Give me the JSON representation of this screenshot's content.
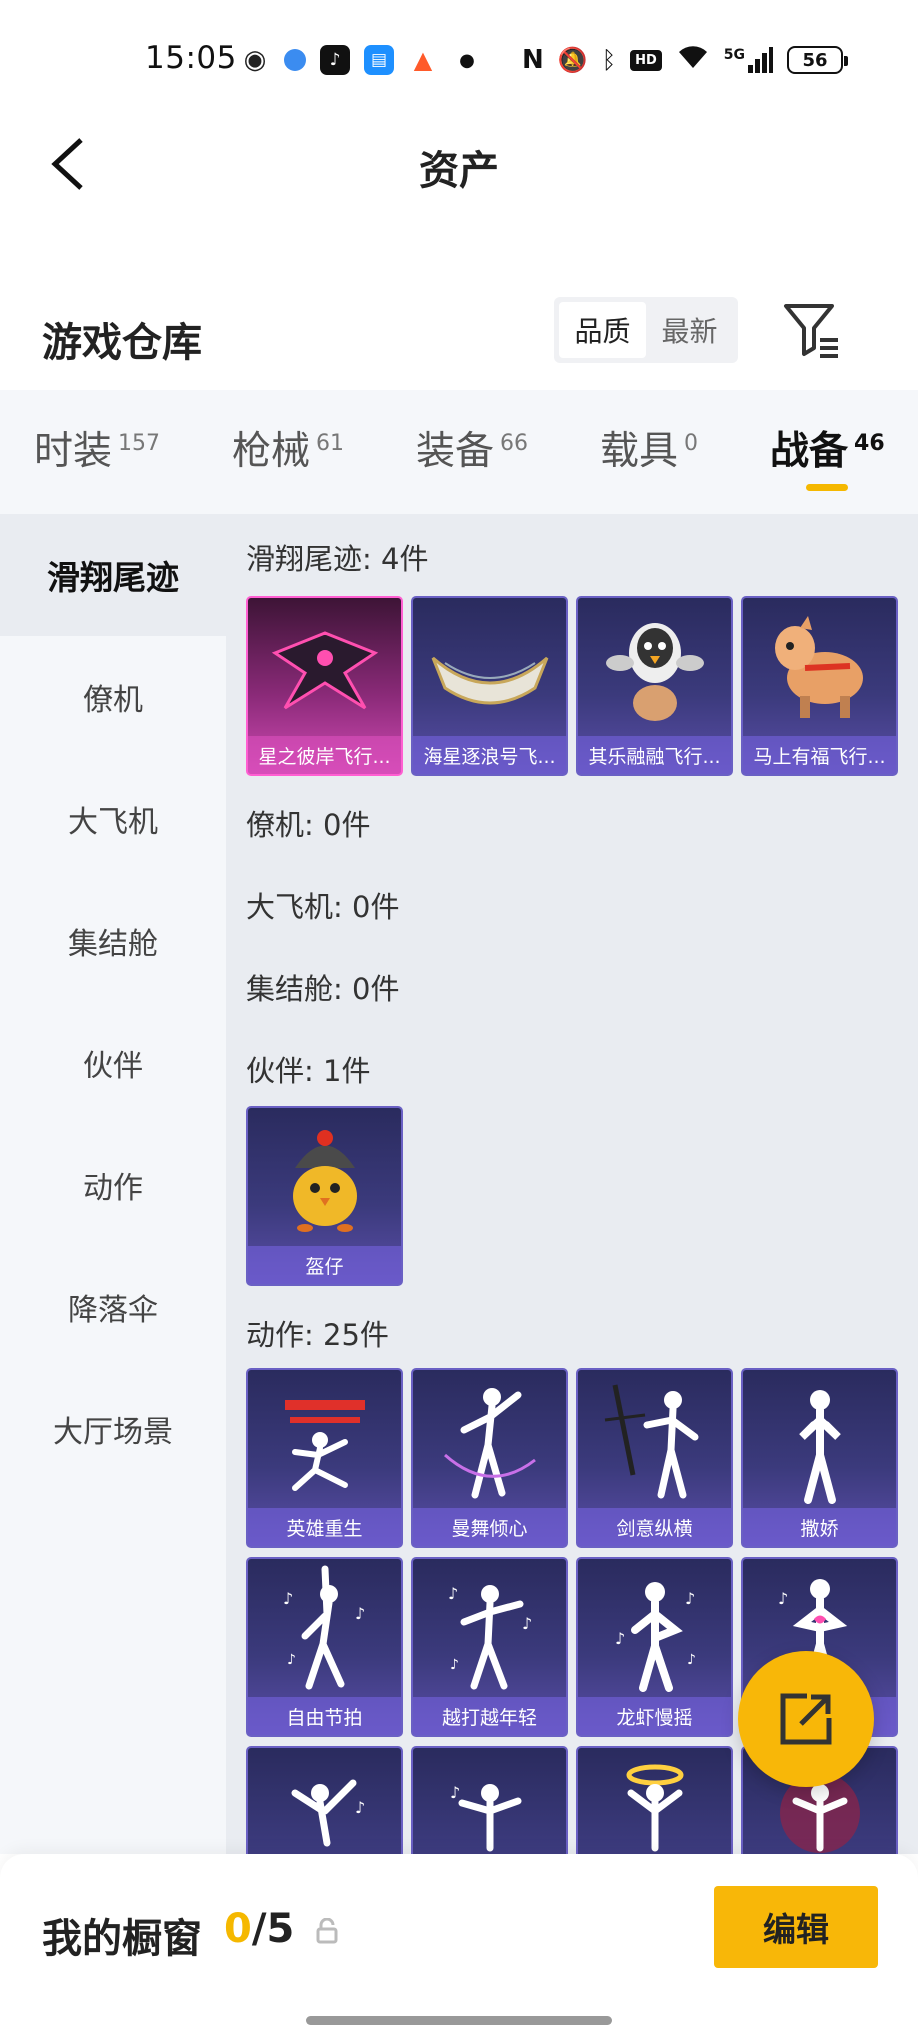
{
  "status_bar": {
    "time": "15:05",
    "battery": "56",
    "network": "5G",
    "hd_label": "HD",
    "icons": [
      "wechat-icon",
      "browser-icon",
      "tiktok-icon",
      "calendar-icon",
      "game-icon",
      "dot-icon",
      "nfc-icon",
      "mute-icon",
      "bluetooth-icon",
      "hd-icon",
      "wifi-icon",
      "signal-icon",
      "battery-icon"
    ]
  },
  "header": {
    "title": "资产",
    "back_icon": "back-arrow-icon"
  },
  "section": {
    "title": "游戏仓库",
    "sort_options": [
      "品质",
      "最新"
    ],
    "sort_selected": "品质",
    "filter_icon": "filter-icon"
  },
  "tabs": [
    {
      "label": "时装",
      "count": "157"
    },
    {
      "label": "枪械",
      "count": "61"
    },
    {
      "label": "装备",
      "count": "66"
    },
    {
      "label": "载具",
      "count": "0"
    },
    {
      "label": "战备",
      "count": "46",
      "active": true
    }
  ],
  "sidebar": [
    {
      "label": "滑翔尾迹",
      "active": true
    },
    {
      "label": "僚机"
    },
    {
      "label": "大飞机"
    },
    {
      "label": "集结舱"
    },
    {
      "label": "伙伴"
    },
    {
      "label": "动作"
    },
    {
      "label": "降落伞"
    },
    {
      "label": "大厅场景"
    }
  ],
  "groups": {
    "glide": {
      "title": "滑翔尾迹: 4件",
      "items": [
        "星之彼岸飞行...",
        "海星逐浪号飞...",
        "其乐融融飞行...",
        "马上有福飞行..."
      ]
    },
    "wingman": {
      "title": "僚机: 0件"
    },
    "plane": {
      "title": "大飞机: 0件"
    },
    "pod": {
      "title": "集结舱: 0件"
    },
    "companion": {
      "title": "伙伴: 1件",
      "items": [
        "盔仔"
      ]
    },
    "emote": {
      "title": "动作: 25件",
      "items": [
        "英雄重生",
        "曼舞倾心",
        "剑意纵横",
        "撒娇",
        "自由节拍",
        "越打越年轻",
        "龙虾慢摇",
        "",
        "",
        "",
        "",
        ""
      ]
    }
  },
  "fab": {
    "icon": "share-icon"
  },
  "bottom": {
    "label": "我的橱窗",
    "current": "0",
    "total": "/5",
    "lock_icon": "lock-icon",
    "edit_label": "编辑"
  },
  "colors": {
    "accent": "#f8b708",
    "card_purple": "#3b3a7c",
    "card_pink": "#d04ab3"
  }
}
